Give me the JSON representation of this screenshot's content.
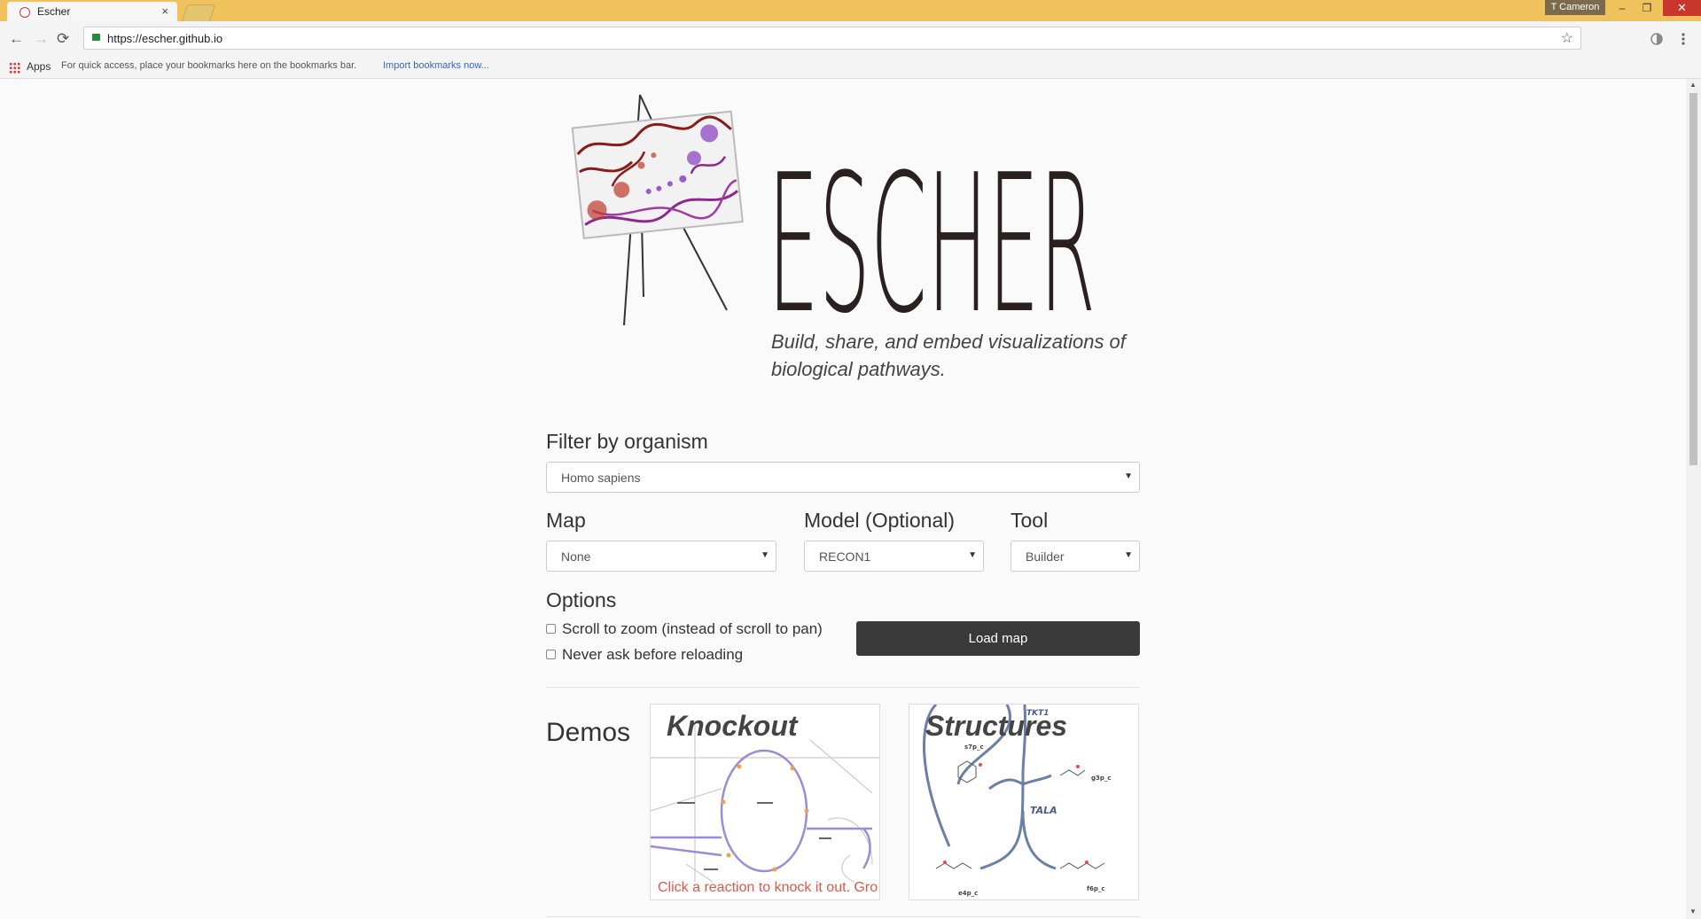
{
  "browser": {
    "tab_title": "Escher",
    "tab_close": "×",
    "profile_name": "T Cameron",
    "window_controls": {
      "minimize": "–",
      "restore": "❐",
      "close": "✕"
    },
    "nav": {
      "back": "←",
      "forward": "→",
      "reload": "⟳",
      "star": "☆"
    },
    "url": "https://escher.github.io",
    "bookmarks_bar": {
      "apps_label": "Apps",
      "hint": "For quick access, place your bookmarks here on the bookmarks bar.",
      "import_link": "Import bookmarks now..."
    }
  },
  "hero": {
    "wordmark": "ESCHER",
    "tagline_line1": "Build, share, and embed visualizations of",
    "tagline_line2": "biological pathways."
  },
  "form": {
    "filter_heading": "Filter by organism",
    "organism_value": "Homo sapiens",
    "map_label": "Map",
    "map_value": "None",
    "model_label": "Model (Optional)",
    "model_value": "RECON1",
    "tool_label": "Tool",
    "tool_value": "Builder",
    "options_heading": "Options",
    "option_scroll_zoom": "Scroll to zoom (instead of scroll to pan)",
    "option_never_ask": "Never ask before reloading",
    "load_button": "Load map"
  },
  "demos": {
    "heading": "Demos",
    "knockout_title": "Knockout",
    "knockout_caption": "Click a reaction to knock it out. Gro",
    "structures_title": "Structures",
    "structures_labels": {
      "tkt1": "TKT1",
      "tala": "TALA",
      "s7p": "s7p_c",
      "g3p": "g3p_c",
      "e4p": "e4p_c",
      "f6p": "f6p_c"
    }
  },
  "colors": {
    "titlebar": "#efc25d",
    "button_dark": "#3a3a3a",
    "caption_red": "#e0574a",
    "pathway_blue": "#6b7fa8",
    "accent_purple": "#9b6bc9",
    "accent_red": "#c0392b"
  },
  "icons": [
    "favicon",
    "close-icon",
    "back-icon",
    "forward-icon",
    "reload-icon",
    "lock-icon",
    "star-icon",
    "apps-icon",
    "dropdown-arrow-icon"
  ]
}
